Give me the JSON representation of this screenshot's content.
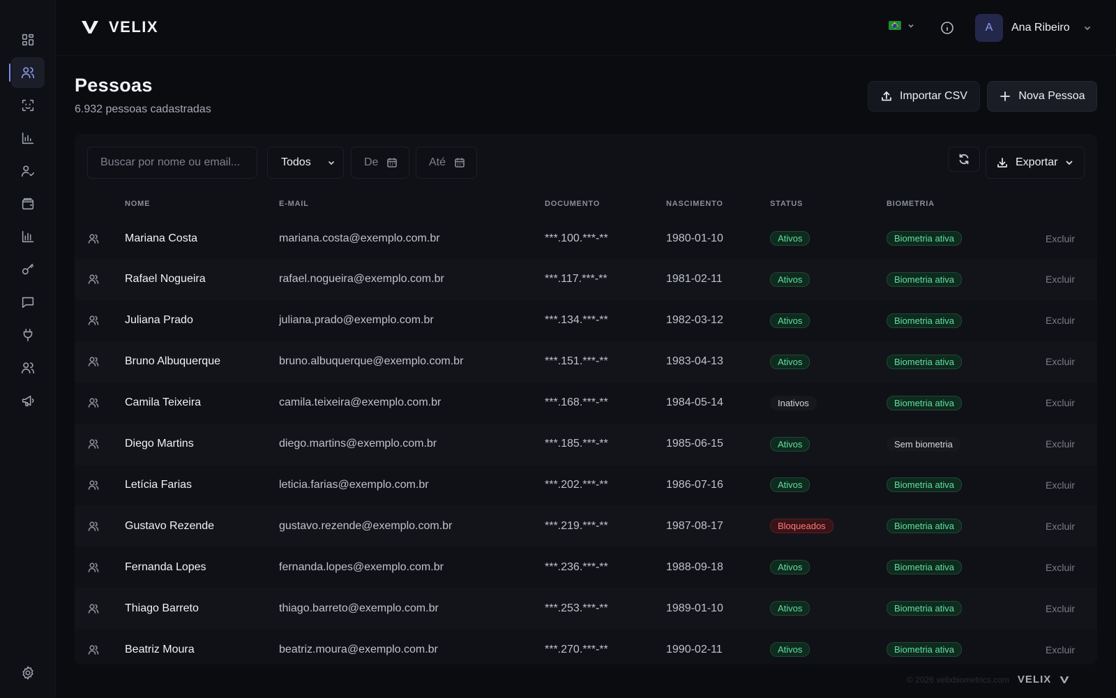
{
  "app": {
    "brand": "VELIX"
  },
  "header": {
    "user_initial": "A",
    "user_name": "Ana Ribeiro"
  },
  "page": {
    "title": "Pessoas",
    "subtitle": "6.932 pessoas cadastradas",
    "import_label": "Importar CSV",
    "new_label": "Nova Pessoa"
  },
  "filters": {
    "search_placeholder": "Buscar por nome ou email...",
    "status_value": "Todos",
    "date_from": "De",
    "date_to": "Até",
    "export_label": "Exportar"
  },
  "table": {
    "columns": [
      "NOME",
      "E-MAIL",
      "DOCUMENTO",
      "NASCIMENTO",
      "STATUS",
      "BIOMETRIA"
    ],
    "delete_label": "Excluir",
    "rows": [
      {
        "name": "Mariana Costa",
        "email": "mariana.costa@exemplo.com.br",
        "doc": "***.100.***-**",
        "birth": "1980-01-10",
        "status": "Ativos",
        "status_kind": "green",
        "bio": "Biometria ativa",
        "bio_kind": "green"
      },
      {
        "name": "Rafael Nogueira",
        "email": "rafael.nogueira@exemplo.com.br",
        "doc": "***.117.***-**",
        "birth": "1981-02-11",
        "status": "Ativos",
        "status_kind": "green",
        "bio": "Biometria ativa",
        "bio_kind": "green"
      },
      {
        "name": "Juliana Prado",
        "email": "juliana.prado@exemplo.com.br",
        "doc": "***.134.***-**",
        "birth": "1982-03-12",
        "status": "Ativos",
        "status_kind": "green",
        "bio": "Biometria ativa",
        "bio_kind": "green"
      },
      {
        "name": "Bruno Albuquerque",
        "email": "bruno.albuquerque@exemplo.com.br",
        "doc": "***.151.***-**",
        "birth": "1983-04-13",
        "status": "Ativos",
        "status_kind": "green",
        "bio": "Biometria ativa",
        "bio_kind": "green"
      },
      {
        "name": "Camila Teixeira",
        "email": "camila.teixeira@exemplo.com.br",
        "doc": "***.168.***-**",
        "birth": "1984-05-14",
        "status": "Inativos",
        "status_kind": "grey",
        "bio": "Biometria ativa",
        "bio_kind": "green"
      },
      {
        "name": "Diego Martins",
        "email": "diego.martins@exemplo.com.br",
        "doc": "***.185.***-**",
        "birth": "1985-06-15",
        "status": "Ativos",
        "status_kind": "green",
        "bio": "Sem biometria",
        "bio_kind": "grey"
      },
      {
        "name": "Letícia Farias",
        "email": "leticia.farias@exemplo.com.br",
        "doc": "***.202.***-**",
        "birth": "1986-07-16",
        "status": "Ativos",
        "status_kind": "green",
        "bio": "Biometria ativa",
        "bio_kind": "green"
      },
      {
        "name": "Gustavo Rezende",
        "email": "gustavo.rezende@exemplo.com.br",
        "doc": "***.219.***-**",
        "birth": "1987-08-17",
        "status": "Bloqueados",
        "status_kind": "red",
        "bio": "Biometria ativa",
        "bio_kind": "green"
      },
      {
        "name": "Fernanda Lopes",
        "email": "fernanda.lopes@exemplo.com.br",
        "doc": "***.236.***-**",
        "birth": "1988-09-18",
        "status": "Ativos",
        "status_kind": "green",
        "bio": "Biometria ativa",
        "bio_kind": "green"
      },
      {
        "name": "Thiago Barreto",
        "email": "thiago.barreto@exemplo.com.br",
        "doc": "***.253.***-**",
        "birth": "1989-01-10",
        "status": "Ativos",
        "status_kind": "green",
        "bio": "Biometria ativa",
        "bio_kind": "green"
      },
      {
        "name": "Beatriz Moura",
        "email": "beatriz.moura@exemplo.com.br",
        "doc": "***.270.***-**",
        "birth": "1990-02-11",
        "status": "Ativos",
        "status_kind": "green",
        "bio": "Biometria ativa",
        "bio_kind": "green"
      }
    ]
  },
  "sidebar": {
    "icons": [
      "dashboard-icon",
      "people-icon",
      "face-scan-icon",
      "bar-chart-icon",
      "user-check-icon",
      "wallet-icon",
      "analytics-icon",
      "key-icon",
      "message-icon",
      "plug-icon",
      "users-icon",
      "megaphone-icon",
      "settings-icon"
    ],
    "active": "people-icon"
  },
  "footer": {
    "copyright": "© 2026 velixbiometrics.com",
    "brand": "VELIX"
  },
  "colors": {
    "accent": "#8c9cf0",
    "success": "#5fe0a0",
    "danger": "#ff7878",
    "background": "#0b0c10"
  }
}
